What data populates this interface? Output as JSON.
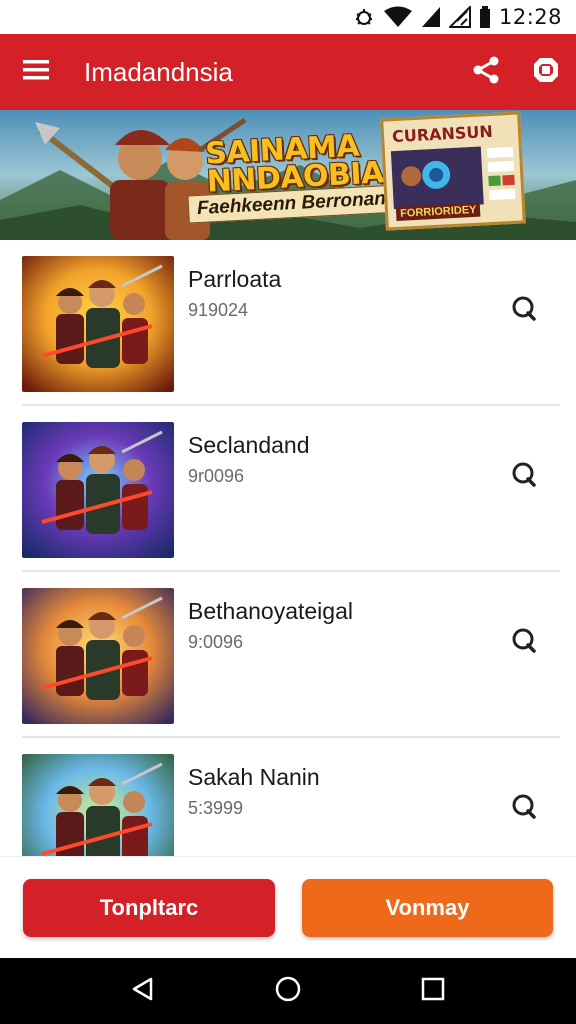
{
  "status_bar": {
    "time": "12:28",
    "icons": [
      "bug-icon",
      "wifi-icon",
      "signal-icon",
      "signal-icon-2",
      "battery-icon"
    ]
  },
  "app_bar": {
    "title": "Imadandnsia",
    "icons": [
      "menu-icon",
      "share-icon",
      "shield-icon"
    ]
  },
  "banner": {
    "title_line1": "SAINAMA",
    "title_line2": "NNDAOBIA",
    "subtitle": "Faehkeenn Berronanl",
    "card_title": "CURANSUN",
    "card_footer": "FORRIORIDEY",
    "colors": {
      "title": "#f6c022",
      "accent": "#8a1c1c"
    }
  },
  "list": {
    "items": [
      {
        "title": "Parrloata",
        "subtitle": "919024",
        "icon": "chat-icon",
        "thumb_theme": "fire"
      },
      {
        "title": "Seclandand",
        "subtitle": "9r0096",
        "icon": "chat-icon",
        "thumb_theme": "neon"
      },
      {
        "title": "Bethanoyateigal",
        "subtitle": "9:0096",
        "icon": "chat-icon",
        "thumb_theme": "city"
      },
      {
        "title": "Sakah Nanin",
        "subtitle": "5:3999",
        "icon": "chat-icon",
        "thumb_theme": "jungle"
      }
    ]
  },
  "actions": {
    "primary_label": "Tonpltarc",
    "secondary_label": "Vonmay",
    "colors": {
      "primary": "#d42027",
      "secondary": "#ee6a1a"
    }
  },
  "nav_bar": {
    "icons": [
      "back-icon",
      "home-icon",
      "recents-icon"
    ]
  },
  "colors": {
    "brand": "#d42027"
  }
}
